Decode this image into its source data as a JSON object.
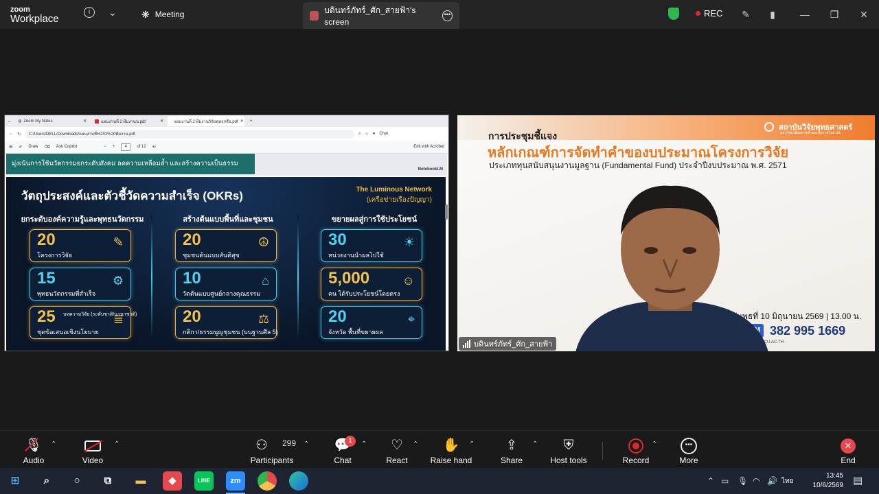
{
  "topbar": {
    "logo_line1": "zoom",
    "logo_line2": "Workplace",
    "meeting_label": "Meeting",
    "screen_tab_label": "บดินทร์ภัทร์_ศัก_สายฟ้า's screen",
    "rec_label": "REC"
  },
  "shared_screen": {
    "browser_tabs": [
      "Zoom My Notes",
      "แผนงานที่ 2 ทีมงานน.pdf",
      "แผนงานที่ 2 ทีมงานวิจัยพุทธหรือ.pdf"
    ],
    "address": "C:/Users/DELL/Downloads/แผนงานที่%202%20ทีมงาน.pdf",
    "pdf_toolbar": {
      "draw": "Draw",
      "ask_copilot": "Ask Copilot",
      "page_current": "4",
      "page_total": "of 12",
      "edit_acrobat": "Edit with Acrobat",
      "chat": "Chat"
    },
    "banner_text": "มุ่งเน้นการใช้นวัตกรรมยกระดับสังคม ลดความเหลื่อมล้ำ และสร้างความเป็นธรรม",
    "notebooklm": "NotebookLM",
    "slide": {
      "title": "วัตถุประสงค์และตัวชี้วัดความสำเร็จ (OKRs)",
      "brand_line1": "The Luminous Network",
      "brand_line2": "(เครือข่ายเรืองปัญญา)",
      "columns": [
        {
          "heading": "ยกระดับองค์ความรู้และพุทธนวัตกรรม",
          "cards": [
            {
              "value": "20",
              "label": "โครงการวิจัย",
              "style": "gold",
              "icon": "lamp-icon",
              "glyph": "✎"
            },
            {
              "value": "15",
              "label": "พุทธนวัตกรรมที่สำเร็จ",
              "style": "cyan",
              "icon": "gear-icon",
              "glyph": "⚙"
            },
            {
              "value": "25",
              "label": "ชุดข้อเสนอเชิงนโยบาย",
              "sub": "บทความวิจัย (ระดับชาติ/นานาชาติ)",
              "style": "gold",
              "icon": "scroll-icon",
              "glyph": "≣"
            }
          ]
        },
        {
          "heading": "สร้างต้นแบบพื้นที่และชุมชน",
          "cards": [
            {
              "value": "20",
              "label": "ชุมชนต้นแบบสันติสุข",
              "style": "gold",
              "icon": "peace-icon",
              "glyph": "☮"
            },
            {
              "value": "10",
              "label": "วัดต้นแบบศูนย์กลางคุณธรรม",
              "style": "cyan",
              "icon": "temple-icon",
              "glyph": "⌂"
            },
            {
              "value": "20",
              "label": "กติกา/ธรรมนูญชุมชน (บนฐานศีล 5)",
              "style": "gold",
              "icon": "scales-icon",
              "glyph": "⚖"
            }
          ]
        },
        {
          "heading": "ขยายผลสู่การใช้ประโยชน์",
          "cards": [
            {
              "value": "30",
              "label": "หน่วยงานนำผลไปใช้",
              "style": "cyan",
              "icon": "lightbulb-icon",
              "glyph": "☀"
            },
            {
              "value": "5,000",
              "label": "คน ได้รับประโยชน์โดยตรง",
              "style": "gold",
              "icon": "people-icon",
              "glyph": "☺"
            },
            {
              "value": "20",
              "label": "จังหวัด พื้นที่ขยายผล",
              "style": "cyan",
              "icon": "map-icon",
              "glyph": "⌖"
            }
          ]
        }
      ]
    }
  },
  "speaker": {
    "institute": "สถาบันวิจัยพุทธศาสตร์",
    "institute_sub": "มหาวิทยาลัยมหาจุฬาลงกรณราชวิทยาลัย",
    "heading1": "การประชุมชี้แจง",
    "heading2": "หลักเกณฑ์การจัดทำคำของบประมาณโครงการวิจัย",
    "heading3": "ประเภททุนสนับสนุนงานมูลฐาน (Fundamental Fund) ประจำปีงบประมาณ พ.ศ. 2571",
    "date": "วันพุธที่ 10 มิถุนายน 2569 | 13.00 น.",
    "zoom_badge": "OM",
    "zoom_id": "382 995 1669",
    "site": "BRI.MCU.AC.TH",
    "name_tag": "บดินทร์ภัทร์_ศัก_สายฟ้า"
  },
  "toolbar": {
    "audio": "Audio",
    "video": "Video",
    "participants": "Participants",
    "participants_count": "299",
    "chat": "Chat",
    "chat_badge": "1",
    "react": "React",
    "raise_hand": "Raise hand",
    "share": "Share",
    "host_tools": "Host tools",
    "record": "Record",
    "more": "More",
    "end": "End"
  },
  "taskbar": {
    "lang": "ไทย",
    "time": "13:45",
    "date": "10/6/2569",
    "zoom_label": "zm"
  },
  "colors": {
    "accent_red": "#e02828",
    "gold": "#f2c14e",
    "cyan": "#4fd3ee",
    "orange": "#e8781e"
  }
}
